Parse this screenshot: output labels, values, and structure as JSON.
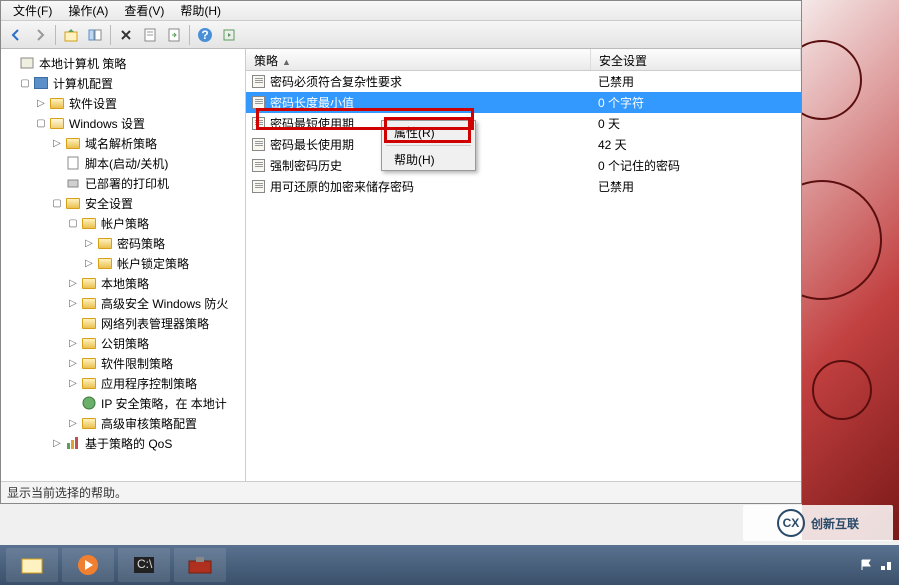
{
  "menubar": {
    "file": "文件(F)",
    "action": "操作(A)",
    "view": "查看(V)",
    "help": "帮助(H)"
  },
  "tree": {
    "root": "本地计算机 策略",
    "computer_config": "计算机配置",
    "software_settings": "软件设置",
    "windows_settings": "Windows 设置",
    "name_resolution": "域名解析策略",
    "scripts": "脚本(启动/关机)",
    "deployed_printers": "已部署的打印机",
    "security_settings": "安全设置",
    "account_policies": "帐户策略",
    "password_policy": "密码策略",
    "lockout_policy": "帐户锁定策略",
    "local_policies": "本地策略",
    "adv_windows_firewall": "高级安全 Windows 防火",
    "network_list_mgr": "网络列表管理器策略",
    "public_key": "公钥策略",
    "software_restrict": "软件限制策略",
    "app_control": "应用程序控制策略",
    "ip_security": "IP 安全策略，在 本地计",
    "adv_audit": "高级审核策略配置",
    "qos": "基于策略的 QoS"
  },
  "list": {
    "header_policy": "策略",
    "header_setting": "安全设置",
    "rows": [
      {
        "policy": "密码必须符合复杂性要求",
        "setting": "已禁用"
      },
      {
        "policy": "密码长度最小值",
        "setting": "0 个字符"
      },
      {
        "policy": "密码最短使用期",
        "setting": "0 天"
      },
      {
        "policy": "密码最长使用期",
        "setting": "42 天"
      },
      {
        "policy": "强制密码历史",
        "setting": "0 个记住的密码"
      },
      {
        "policy": "用可还原的加密来储存密码",
        "setting": "已禁用"
      }
    ]
  },
  "context_menu": {
    "properties": "属性(R)",
    "help": "帮助(H)"
  },
  "statusbar": "显示当前选择的帮助。",
  "watermark": {
    "logo": "CX",
    "text": "创新互联"
  }
}
